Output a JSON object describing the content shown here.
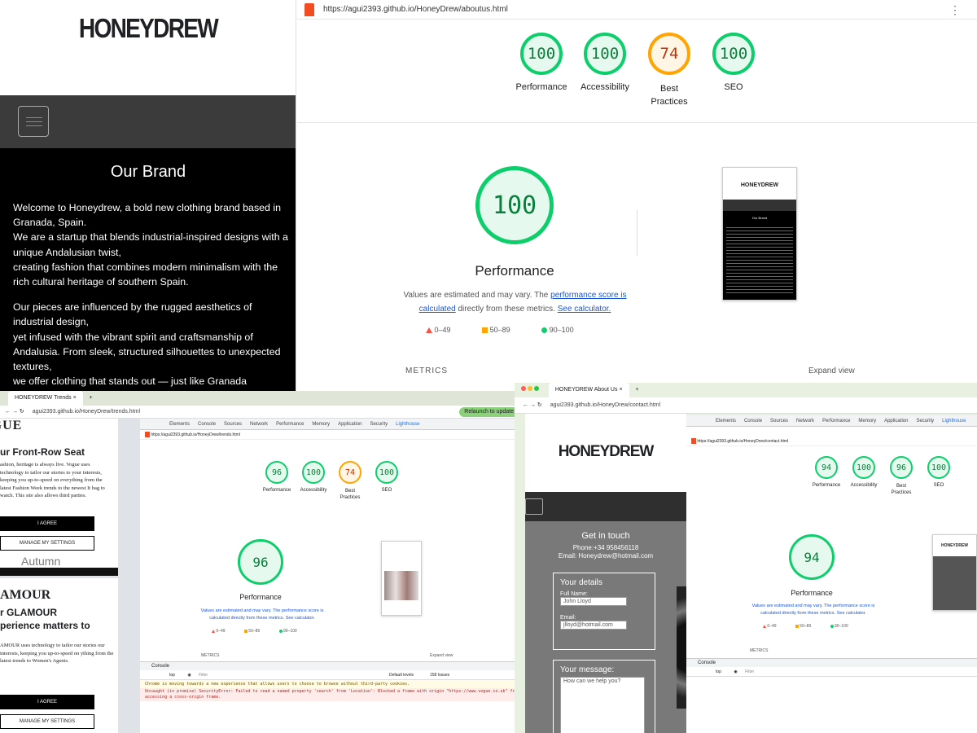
{
  "site": {
    "logo": "HONEYDREW",
    "heading": "Our Brand",
    "paragraphs": [
      [
        "Welcome to Honeydrew, a bold new clothing brand based in Granada, Spain.",
        "We are a startup that blends industrial-inspired designs with a unique Andalusian twist,",
        "creating fashion that combines modern minimalism with the rich cultural heritage of southern Spain."
      ],
      [
        "Our pieces are influenced by the rugged aesthetics of industrial design,",
        "yet infused with the vibrant spirit and craftsmanship of Andalusia. From sleek, structured silhouettes to unexpected textures,",
        "we offer clothing that stands out — just like Granada"
      ]
    ]
  },
  "lighthouse_main": {
    "url": "https://agui2393.github.io/HoneyDrew/aboutus.html",
    "scores": [
      {
        "value": "100",
        "label": "Performance",
        "color": "#0cce6b"
      },
      {
        "value": "100",
        "label": "Accessibility",
        "color": "#0cce6b"
      },
      {
        "value": "74",
        "label": "Best Practices",
        "color": "#ffa400"
      },
      {
        "value": "100",
        "label": "SEO",
        "color": "#0cce6b"
      }
    ],
    "big_score": "100",
    "big_label": "Performance",
    "note_prefix": "Values are estimated and may vary. The ",
    "note_link1": "performance score is calculated",
    "note_mid": " directly from these metrics. ",
    "note_link2": "See calculator.",
    "legend": [
      "0–49",
      "50–89",
      "90–100"
    ],
    "metrics_label": "METRICS",
    "expand_label": "Expand view",
    "thumb_logo": "HONEYDREW",
    "thumb_heading": "Our Brand"
  },
  "browser_left": {
    "tab_title": "HONEYDREW Trends",
    "url": "agui2393.github.io/HoneyDrew/trends.html",
    "update_button": "Relaunch to update",
    "devtools_tabs": [
      "Elements",
      "Console",
      "Sources",
      "Network",
      "Performance",
      "Memory",
      "Application",
      "Security",
      "Lighthouse"
    ],
    "lh_url": "https://agui2393.github.io/HoneyDrew/trends.html",
    "scores": [
      {
        "value": "96",
        "label": "Performance"
      },
      {
        "value": "100",
        "label": "Accessibility"
      },
      {
        "value": "74",
        "label": "Best Practices"
      },
      {
        "value": "100",
        "label": "SEO"
      }
    ],
    "big_score": "96",
    "big_label": "Performance",
    "note": "Values are estimated and may vary. The performance score is calculated directly from these metrics. See calculator.",
    "legend": [
      "0–49",
      "50–89",
      "90–100"
    ],
    "metrics_label": "METRICS",
    "expand_label": "Expand view",
    "vogue": {
      "brand": "VOGUE",
      "headline": "ur Front-Row Seat",
      "body": "ashion, heritage is always live. Vogue uses technology to tailor our stories to your interests, keeping you up-to-speed on everything from the latest Fashion Week trends to the newest It bag to watch. This site also allows third parties.",
      "agree": "I AGREE",
      "manage": "MANAGE MY SETTINGS",
      "autumn": "Autumn"
    },
    "glamour": {
      "brand": "AMOUR",
      "headline": "r GLAMOUR perience matters to",
      "body": "AMOUR uses technology to tailor our stories our interests, keeping you up-to-speed on ything from the latest trends to Women's Agents.",
      "agree": "I AGREE",
      "manage": "MANAGE MY SETTINGS"
    },
    "console_label": "Console",
    "filter_placeholder": "Filter",
    "top_label": "top",
    "levels_label": "Default levels",
    "issues_label": "158 Issues",
    "warning_text": "Chrome is moving towards a new experience that allows users to choose to browse without third-party cookies.",
    "error_text": "Uncaught (in promise) SecurityError: Failed to read a named property 'search' from 'Location': Blocked a frame with origin \"https://www.vogue.co.uk\" from accessing a cross-origin frame."
  },
  "browser_right": {
    "tab_title": "HONEYDREW About Us",
    "url": "agui2393.github.io/HoneyDrew/contact.html",
    "lh_url": "https://agui2393.github.io/HoneyDrew/contact.html",
    "devtools_tabs": [
      "Elements",
      "Console",
      "Sources",
      "Network",
      "Performance",
      "Memory",
      "Application",
      "Security",
      "Lighthouse"
    ],
    "logo": "HONEYDREW",
    "contact": {
      "title": "Get in touch",
      "phone": "Phone:+34 958456118",
      "email": "Email: Honeydrew@hotmail.com",
      "details_title": "Your details",
      "name_label": "Full Name:",
      "name_value": "John Lloyd",
      "email_label": "Email:",
      "email_value": "jlloyd@hotmail.com",
      "message_title": "Your message:",
      "message_placeholder": "How can we help you?"
    },
    "scores": [
      {
        "value": "94",
        "label": "Performance"
      },
      {
        "value": "100",
        "label": "Accessibility"
      },
      {
        "value": "96",
        "label": "Best Practices"
      },
      {
        "value": "100",
        "label": "SEO"
      }
    ],
    "big_score": "94",
    "big_label": "Performance",
    "note": "Values are estimated and may vary. The performance score is calculated directly from these metrics. See calculator.",
    "legend": [
      "0–49",
      "50–89",
      "90–100"
    ],
    "metrics_label": "METRICS",
    "console_label": "Console",
    "filter_placeholder": "Filter",
    "top_label": "top"
  }
}
